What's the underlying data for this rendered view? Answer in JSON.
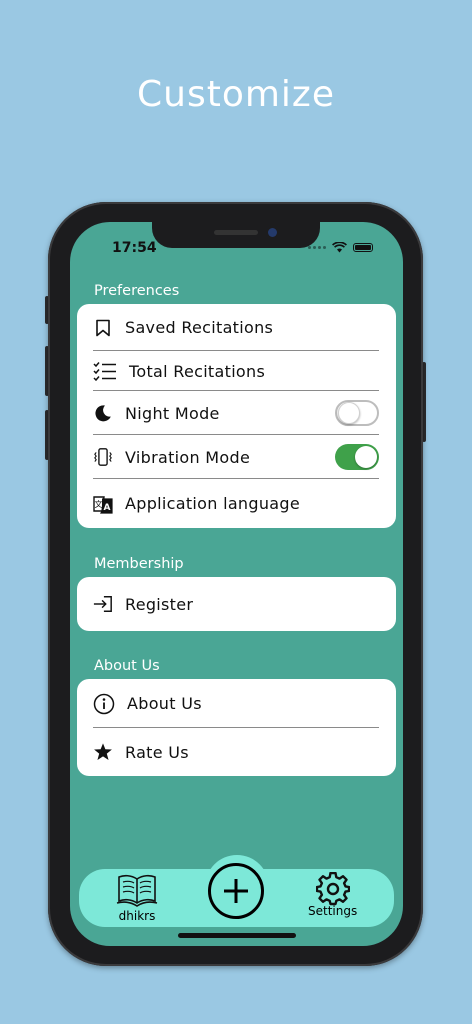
{
  "headline": "Customize",
  "status_bar": {
    "time": "17:54"
  },
  "sections": {
    "preferences": {
      "label": "Preferences",
      "items": [
        {
          "label": "Saved Recitations",
          "icon": "bookmark-icon"
        },
        {
          "label": "Total Recitations",
          "icon": "checklist-icon"
        },
        {
          "label": "Night Mode",
          "icon": "moon-icon",
          "toggle": false
        },
        {
          "label": "Vibration Mode",
          "icon": "vibration-icon",
          "toggle": true
        },
        {
          "label": "Application language",
          "icon": "translate-icon"
        }
      ]
    },
    "membership": {
      "label": "Membership",
      "items": [
        {
          "label": "Register",
          "icon": "login-icon"
        }
      ]
    },
    "about": {
      "label": "About Us",
      "items": [
        {
          "label": "About Us",
          "icon": "info-icon"
        },
        {
          "label": "Rate Us",
          "icon": "star-icon"
        }
      ]
    }
  },
  "tabbar": {
    "left_label": "dhikrs",
    "right_label": "Settings",
    "center": "add-icon"
  },
  "colors": {
    "background": "#9ac8e3",
    "screen": "#4aa695",
    "tabbar": "#7de8d8",
    "toggle_on": "#3fa14a"
  }
}
